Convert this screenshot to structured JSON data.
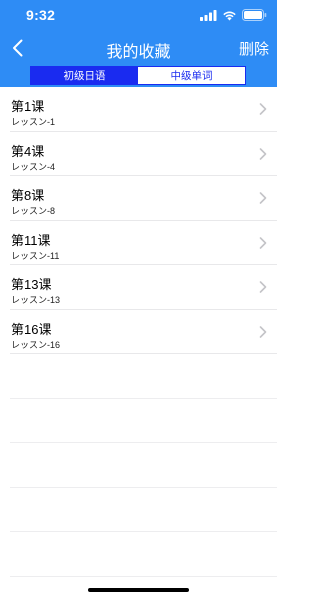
{
  "status_bar": {
    "time": "9:32",
    "icons": [
      "signal-icon",
      "wifi-icon",
      "battery-icon"
    ]
  },
  "nav": {
    "back_icon": "chevron-left-icon",
    "title": "我的收藏",
    "delete_label": "删除"
  },
  "tabs": [
    {
      "label": "初级日语",
      "selected": true
    },
    {
      "label": "中级单词",
      "selected": false
    }
  ],
  "lessons": [
    {
      "title": "第1课",
      "subtitle": "レッスン-1"
    },
    {
      "title": "第4课",
      "subtitle": "レッスン-4"
    },
    {
      "title": "第8课",
      "subtitle": "レッスン-8"
    },
    {
      "title": "第11课",
      "subtitle": "レッスン-11"
    },
    {
      "title": "第13课",
      "subtitle": "レッスン-13"
    },
    {
      "title": "第16课",
      "subtitle": "レッスン-16"
    }
  ],
  "colors": {
    "header_bg": "#2e8cf5",
    "segment_accent": "#1a2bf0",
    "chevron": "#c4c4c8"
  }
}
